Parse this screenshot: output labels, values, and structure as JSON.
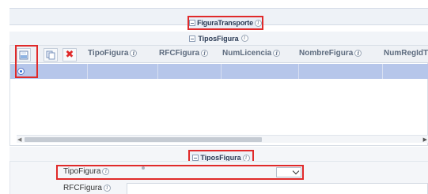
{
  "header": {
    "section_title": "FiguraTransporte",
    "sub_section_title": "TiposFigura"
  },
  "grid": {
    "toolbar": {
      "add_icon": "add-record-icon",
      "copy_icon": "copy-icon",
      "delete_icon": "delete-x-icon",
      "delete_glyph": "✖"
    },
    "columns": [
      "TipoFigura",
      "RFCFigura",
      "NumLicencia",
      "NombreFigura",
      "NumRegIdTri"
    ],
    "selected_row_index": 0,
    "row_highlight_color": "#b6c6ea"
  },
  "form": {
    "section_title": "TiposFigura",
    "fields": [
      {
        "label": "TipoFigura",
        "type": "select",
        "value": ""
      },
      {
        "label": "RFCFigura",
        "type": "text",
        "value": ""
      }
    ]
  },
  "colors": {
    "highlight_border": "#e02a2a",
    "header_bg": "#eef2f7",
    "selected_row": "#b6c6ea"
  },
  "info_glyph": "i"
}
